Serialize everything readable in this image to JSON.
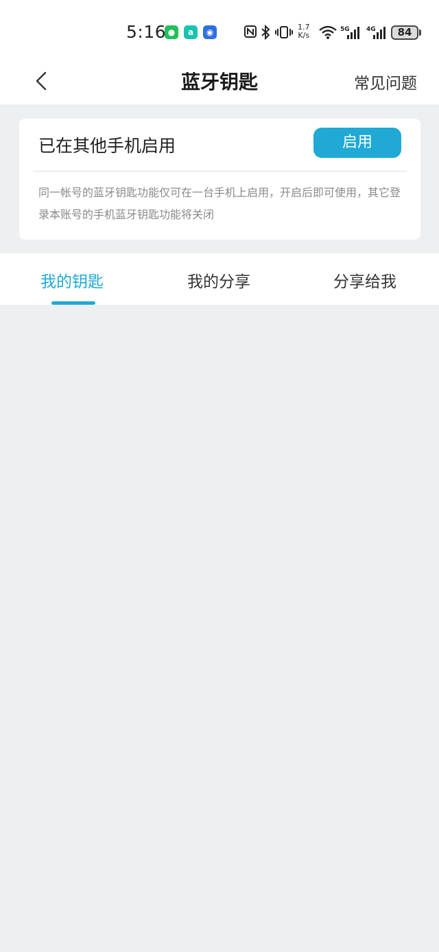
{
  "status_bar": {
    "time": "5:16",
    "net_speed_value": "1.7",
    "net_speed_unit": "K/s",
    "signal1_label": "5G",
    "signal2_label": "4G",
    "battery": "84",
    "icons": [
      "wechat-icon",
      "app-a-icon",
      "app-blue-icon",
      "nfc-icon",
      "bluetooth-icon",
      "vibrate-icon",
      "wifi-icon"
    ]
  },
  "nav": {
    "title": "蓝牙钥匙",
    "faq": "常见问题"
  },
  "notice": {
    "title": "已在其他手机启用",
    "enable_button": "启用",
    "description": "同一帐号的蓝牙钥匙功能仅可在一台手机上启用，开启后即可使用，其它登录本账号的手机蓝牙钥匙功能将关闭"
  },
  "tabs": {
    "my_keys": "我的钥匙",
    "my_shares": "我的分享",
    "shared_to_me": "分享给我"
  },
  "colors": {
    "accent": "#1fa9d4",
    "background": "#eeeff1",
    "card": "#ffffff"
  }
}
